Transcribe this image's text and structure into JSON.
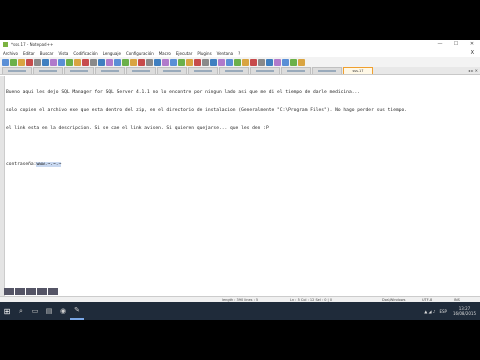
{
  "window": {
    "title": "*sss.17 - Notepad++",
    "controls": [
      "—",
      "☐",
      "✕"
    ]
  },
  "menu": [
    "Archivo",
    "Editar",
    "Buscar",
    "Vista",
    "Codificación",
    "Lenguaje",
    "Configuración",
    "Macro",
    "Ejecutar",
    "Plugins",
    "Ventana",
    "?"
  ],
  "menu_close": "X",
  "toolbar_buttons": 38,
  "tabs": {
    "count": 12,
    "active_label": "sss.17",
    "active_index": 11,
    "nav": "◂ ▸ ✕"
  },
  "editor": {
    "lines": [
      "Bueno aqui les dejo SQL Manager for SQL Server 4.1.1 no lo encontre por ningun lado asi que me di el tiempo de darle medicina...",
      "solo copien el archivo exe que esta dentro del zip, en el directorio de instalacion (Generalmente \"C:\\Program Files\"). No hago perder sus tiempo.",
      "el link esta en la descripcion. Si se cae el link avisen. Si quieren quejarse... que les den :P",
      "",
      "contraseña:"
    ],
    "password_highlight": "www.~.~.~"
  },
  "statusbar": {
    "length": "length : 390   lines : 5",
    "position": "Ln : 5   Col : 12   Sel : 0 | 0",
    "eol": "Dos\\Windows",
    "encoding": "UTF-8",
    "mode": "INS"
  },
  "taskbar": {
    "start_icon": "windows-icon",
    "items": [
      "search-icon",
      "task-view-icon",
      "explorer-icon",
      "browser-icon",
      "notepadpp-icon"
    ],
    "tray_lang": "ESP",
    "time": "13:27",
    "date": "16/08/2015"
  }
}
